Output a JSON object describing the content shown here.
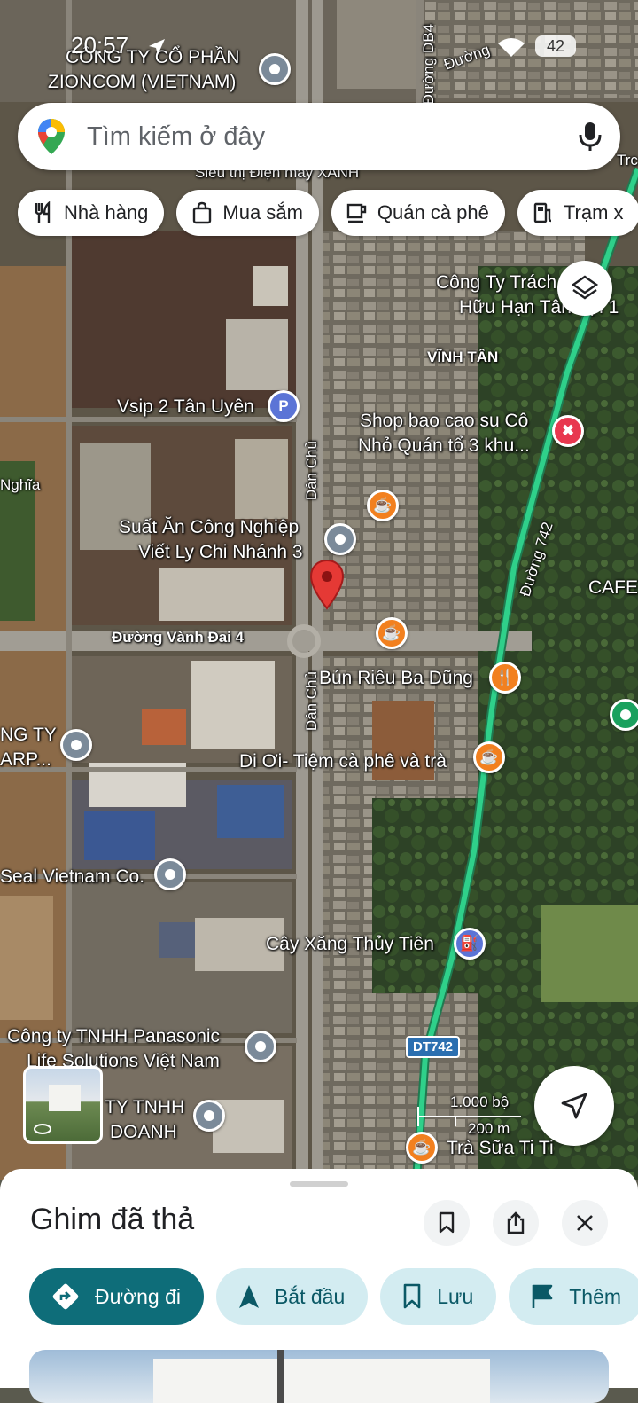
{
  "status_bar": {
    "time": "20:57",
    "battery": "42"
  },
  "search": {
    "placeholder": "Tìm kiếm ở đây"
  },
  "chips": [
    {
      "label": "Nhà hàng",
      "icon": "restaurant-icon"
    },
    {
      "label": "Mua sắm",
      "icon": "shopping-bag-icon"
    },
    {
      "label": "Quán cà phê",
      "icon": "coffee-icon"
    },
    {
      "label": "Trạm x",
      "icon": "gas-station-icon"
    }
  ],
  "map": {
    "roads": {
      "dan_chu_1": "Dân Chủ",
      "dan_chu_2": "Dân Chủ",
      "vanh_dai_4": "Đường Vành Đai 4",
      "duong_742": "Đường 742",
      "dt742_shield": "DT742",
      "db4": "Đường DB4",
      "duong_top": "Đường"
    },
    "areas": {
      "vinh_tan": "VĨNH TÂN",
      "nghia": "Nghĩa",
      "cafe": "CAFE"
    },
    "places": {
      "zioncom_1": "CÔNG TY CỔ PHẦN",
      "zioncom_2": "ZIONCOM (VIETNAM)",
      "dienmay": "Siêu thị Điện máy XANH",
      "cong_ty_trach_1": "Công Ty Trách",
      "cong_ty_trach_2": "Hữu Hạn Tân Lợi 1",
      "vsip": "Vsip 2 Tân Uyên",
      "shop_1": "Shop bao cao su Cô",
      "shop_2": "Nhỏ Quán tổ 3 khu...",
      "suat_an_1": "Suất Ăn Công Nghiệp",
      "suat_an_2": "Viết Ly Chi Nhánh 3",
      "bun_rieu": "Bún Riêu Ba Dũng",
      "ng_ty_1": "NG TY",
      "ng_ty_2": "ARP...",
      "di_oi": "Di Ơi- Tiệm cà phê và trà",
      "seal": "Seal Vietnam Co.",
      "cay_xang": "Cây Xăng Thủy Tiên",
      "panasonic_1": "Công ty TNHH Panasonic",
      "panasonic_2": "Life Solutions Việt Nam",
      "tnhh_1": "TY TNHH",
      "tnhh_2": "DOANH",
      "tra_sua": "Trà Sữa Ti Ti",
      "tra_top": "Trc"
    },
    "scale": {
      "imperial": "1.000 bộ",
      "metric": "200 m"
    },
    "parking_letter": "P"
  },
  "sheet": {
    "title": "Ghim đã thả",
    "actions": [
      {
        "label": "Đường đi",
        "icon": "directions-icon"
      },
      {
        "label": "Bắt đầu",
        "icon": "navigation-arrow-icon"
      },
      {
        "label": "Lưu",
        "icon": "bookmark-icon"
      },
      {
        "label": "Thêm",
        "icon": "flag-icon"
      }
    ]
  },
  "colors": {
    "accent_teal": "#0e6d79",
    "action_bg": "#d3ecf1",
    "route_green": "#2fd08a",
    "pin_red": "#e53935",
    "poi_orange": "#f2801f"
  }
}
